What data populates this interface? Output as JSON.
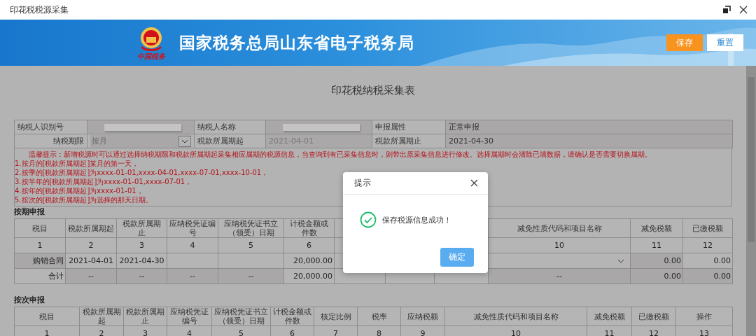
{
  "window": {
    "title": "印花税税源采集"
  },
  "banner": {
    "logo_text": "中国税务",
    "title": "国家税务总局山东省电子税务局",
    "buttons": [
      {
        "label": "保存",
        "kind": "primary"
      },
      {
        "label": "重置",
        "kind": "secondary"
      }
    ]
  },
  "form": {
    "title": "印花税纳税采集表",
    "rows": [
      [
        {
          "label": "纳税人识别号",
          "kind": "redacted"
        },
        {
          "label": "纳税人名称",
          "kind": "redacted"
        },
        {
          "label": "申报属性",
          "kind": "text",
          "value": "正常申报"
        }
      ],
      [
        {
          "label": "纳税期限",
          "kind": "select",
          "value": "按月"
        },
        {
          "label": "税款所属期起",
          "kind": "input",
          "value": "2021-04-01"
        },
        {
          "label": "税款所属期止",
          "kind": "text",
          "value": "2021-04-30"
        }
      ]
    ],
    "notice": [
      "温馨提示：新增税源时可以通过选择纳税期限和税款所属期起采集相应属期的税源信息，当查询到有已采集信息时，则带出原采集信息进行修改。选择属期时会清除已填数据，请确认是否需要切换属期。",
      "1.按月的[税款所属期起]某月的第一天，",
      "2.按季的[税款所属期起]为xxxx-01-01,xxxx-04-01,xxxx-07-01,xxxx-10-01，",
      "3.按半年的[税款所属期起]为xxxx-01-01,xxxx-07-01，",
      "4.按年的[税款所属期起]为xxxx-01-01，",
      "5.按次的[税款所属期起]为选择的那天日期。"
    ]
  },
  "tables": [
    {
      "title": "按期申报",
      "columns": [
        {
          "header": "税目",
          "number": "1"
        },
        {
          "header": "税款所属期起",
          "number": "2"
        },
        {
          "header": "税款所属期止",
          "number": "3"
        },
        {
          "header": "应纳税凭证编号",
          "number": "4"
        },
        {
          "header": "应纳税凭证书立（领受）日期",
          "number": "5"
        },
        {
          "header": "计税金额或件数",
          "number": "6"
        },
        null,
        null,
        null,
        {
          "header": "减免性质代码和项目名称",
          "number": "10"
        },
        {
          "header": "减免税额",
          "number": "11"
        },
        {
          "header": "已缴税额",
          "number": "12"
        }
      ],
      "rows": [
        {
          "cells": [
            {
              "text": "购销合同",
              "readonly": true
            },
            {
              "text": "2021-04-01",
              "readonly": false
            },
            {
              "text": "2021-04-30",
              "readonly": false
            },
            {
              "readonly": false
            },
            {
              "readonly": false
            },
            {
              "text": "20,000.00",
              "readonly": false
            },
            null,
            null,
            null,
            {
              "kind": "select",
              "readonly": false
            },
            {
              "text": "0.00",
              "readonly": true
            },
            {
              "text": "0.00",
              "readonly": false
            }
          ]
        },
        {
          "cells": [
            {
              "text": "合计",
              "readonly": false
            },
            {
              "text": "--",
              "readonly": true
            },
            {
              "text": "--",
              "readonly": true
            },
            {
              "text": "--",
              "readonly": true
            },
            {
              "text": "--",
              "readonly": true
            },
            {
              "text": "20,000.00",
              "readonly": false
            },
            null,
            null,
            null,
            {
              "text": "--",
              "readonly": true
            },
            {
              "text": "0.00",
              "readonly": true
            },
            {
              "text": "0.00",
              "readonly": true
            }
          ]
        }
      ]
    },
    {
      "title": "按次申报",
      "columns": [
        {
          "header": "税目",
          "number": "1"
        },
        {
          "header": "税款所属期起",
          "number": "2"
        },
        {
          "header": "税款所属期止",
          "number": "3"
        },
        {
          "header": "应纳税凭证编号",
          "number": "4"
        },
        {
          "header": "应纳税凭证书立（领受）日期",
          "number": "5"
        },
        {
          "header": "计税金额或件数",
          "number": "6"
        },
        {
          "header": "核定比例",
          "number": "7"
        },
        {
          "header": "税率",
          "number": "8"
        },
        {
          "header": "应纳税额",
          "number": "9"
        },
        {
          "header": "减免性质代码和项目名称",
          "number": "10"
        },
        {
          "header": "减免税额",
          "number": "11"
        },
        {
          "header": "已缴税额",
          "number": "12"
        },
        {
          "header": "操作",
          "number": "13"
        }
      ]
    }
  ],
  "dialog": {
    "title": "提示",
    "message": "保存税源信息成功！",
    "button": "确定"
  }
}
